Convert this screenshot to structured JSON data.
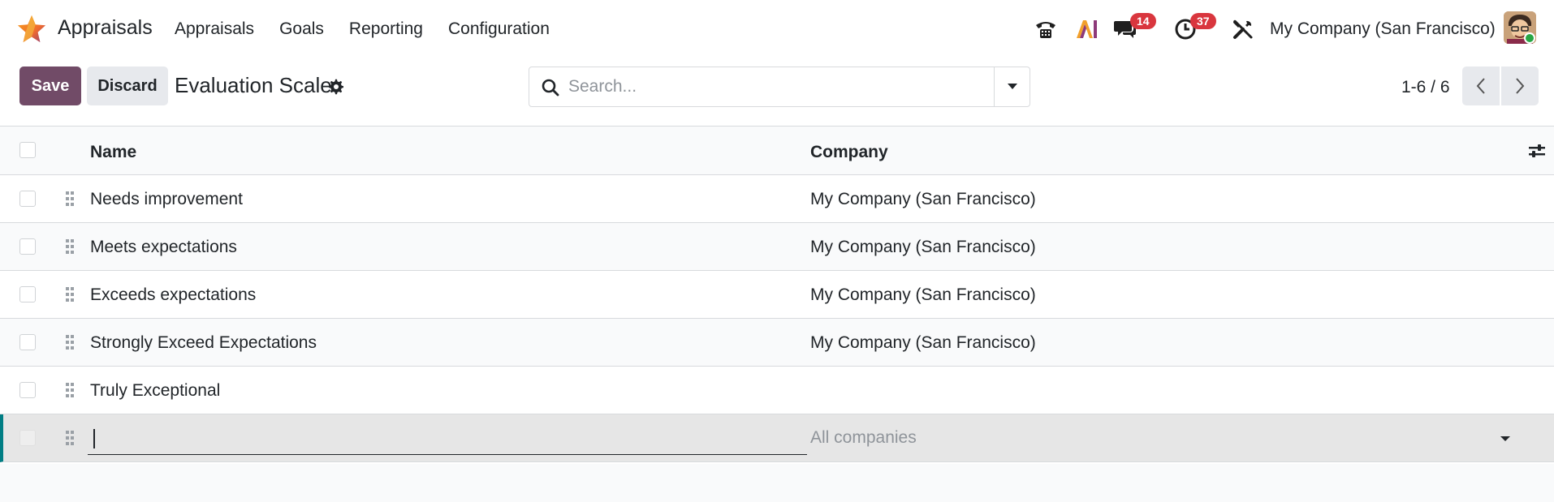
{
  "app": {
    "name": "Appraisals",
    "menu": [
      "Appraisals",
      "Goals",
      "Reporting",
      "Configuration"
    ]
  },
  "systray": {
    "messages_count": "14",
    "activities_count": "37",
    "company": "My Company (San Francisco)"
  },
  "control_panel": {
    "save_label": "Save",
    "discard_label": "Discard",
    "title": "Evaluation Scale",
    "search_placeholder": "Search...",
    "pager": "1-6 / 6"
  },
  "list": {
    "columns": {
      "name": "Name",
      "company": "Company"
    },
    "rows": [
      {
        "name": "Needs improvement",
        "company": "My Company (San Francisco)"
      },
      {
        "name": "Meets expectations",
        "company": "My Company (San Francisco)"
      },
      {
        "name": "Exceeds expectations",
        "company": "My Company (San Francisco)"
      },
      {
        "name": "Strongly Exceed Expectations",
        "company": "My Company (San Francisco)"
      },
      {
        "name": "Truly Exceptional",
        "company": ""
      }
    ],
    "new_row": {
      "name_value": "",
      "company_placeholder": "All companies"
    }
  },
  "colors": {
    "brand": "#714b67",
    "badge": "#d9363e",
    "edit_accent": "#017e84"
  },
  "icons": {
    "logo": "appraisals-star-icon",
    "phone": "phone-icon",
    "ai": "ai-icon",
    "chat": "chat-icon",
    "activity": "clock-icon",
    "tools": "tools-icon",
    "gear": "gear-icon",
    "search": "search-icon",
    "caret": "caret-down-icon",
    "prev": "chevron-left-icon",
    "next": "chevron-right-icon",
    "drag": "drag-handle-icon",
    "optional_columns": "sliders-icon"
  }
}
